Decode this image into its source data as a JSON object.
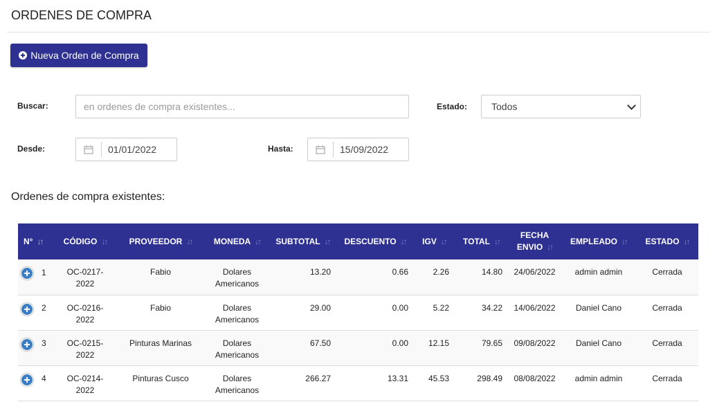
{
  "page": {
    "title": "ORDENES DE COMPRA"
  },
  "toolbar": {
    "new_order_label": "Nueva Orden de Compra"
  },
  "filters": {
    "search_label": "Buscar:",
    "search_placeholder": "en ordenes de compra existentes...",
    "search_value": "",
    "estado_label": "Estado:",
    "estado_value": "Todos",
    "desde_label": "Desde:",
    "desde_value": "01/01/2022",
    "hasta_label": "Hasta:",
    "hasta_value": "15/09/2022"
  },
  "section": {
    "subtitle": "Ordenes de compra existentes:"
  },
  "colors": {
    "accent": "#2e3192",
    "expand": "#3a7fc4"
  },
  "table": {
    "headers": [
      "N°",
      "CÓDIGO",
      "PROVEEDOR",
      "MONEDA",
      "SUBTOTAL",
      "DESCUENTO",
      "IGV",
      "TOTAL",
      "FECHA ENVIO",
      "EMPLEADO",
      "ESTADO"
    ],
    "fecha_line1": "FECHA",
    "fecha_line2": "ENVIO",
    "rows": [
      {
        "n": "1",
        "code1": "OC-0217-",
        "code2": "2022",
        "proveedor": "Fabio",
        "moneda1": "Dolares",
        "moneda2": "Americanos",
        "subtotal": "13.20",
        "descuento": "0.66",
        "igv": "2.26",
        "total": "14.80",
        "fecha": "24/06/2022",
        "empleado": "admin admin",
        "estado": "Cerrada"
      },
      {
        "n": "2",
        "code1": "OC-0216-",
        "code2": "2022",
        "proveedor": "Fabio",
        "moneda1": "Dolares",
        "moneda2": "Americanos",
        "subtotal": "29.00",
        "descuento": "0.00",
        "igv": "5.22",
        "total": "34.22",
        "fecha": "14/06/2022",
        "empleado": "Daniel Cano",
        "estado": "Cerrada"
      },
      {
        "n": "3",
        "code1": "OC-0215-",
        "code2": "2022",
        "proveedor": "Pinturas Marinas",
        "moneda1": "Dolares",
        "moneda2": "Americanos",
        "subtotal": "67.50",
        "descuento": "0.00",
        "igv": "12.15",
        "total": "79.65",
        "fecha": "09/08/2022",
        "empleado": "Daniel Cano",
        "estado": "Cerrada"
      },
      {
        "n": "4",
        "code1": "OC-0214-",
        "code2": "2022",
        "proveedor": "Pinturas Cusco",
        "moneda1": "Dolares",
        "moneda2": "Americanos",
        "subtotal": "266.27",
        "descuento": "13.31",
        "igv": "45.53",
        "total": "298.49",
        "fecha": "08/08/2022",
        "empleado": "admin admin",
        "estado": "Cerrada"
      }
    ]
  }
}
